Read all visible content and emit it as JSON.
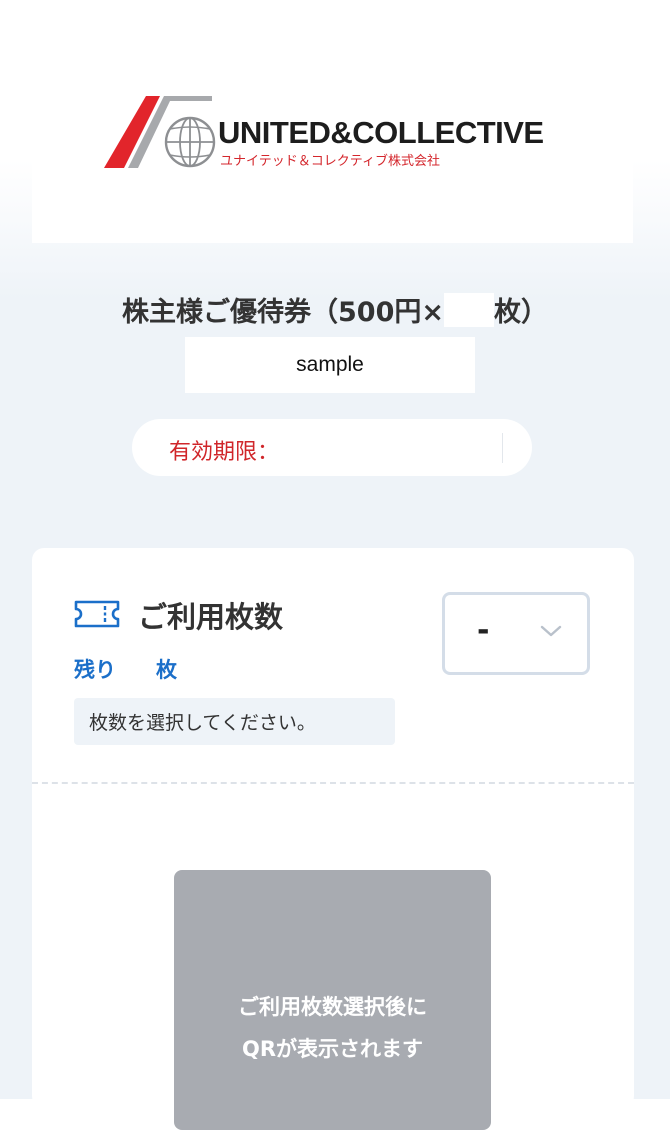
{
  "brand": {
    "name": "UNITED&COLLECTIVE",
    "name_kana": "ユナイテッド＆コレクティブ株式会社",
    "colors": {
      "red": "#d4262c",
      "gray": "#a7a9ac"
    }
  },
  "ticket": {
    "title_prefix": "株主様ご優待券（500円×",
    "title_suffix": "枚）",
    "holder_name": "sample",
    "expiry_label": "有効期限："
  },
  "usage": {
    "icon": "ticket-icon",
    "title": "ご利用枚数",
    "remaining_label": "残り",
    "remaining_unit": "枚",
    "hint": "枚数を選択してください。",
    "quantity_selected": "-",
    "dropdown_icon": "chevron-down-icon",
    "accent_color": "#1b6fc9"
  },
  "qr": {
    "line1": "ご利用枚数選択後に",
    "line2": "QRが表示されます"
  }
}
